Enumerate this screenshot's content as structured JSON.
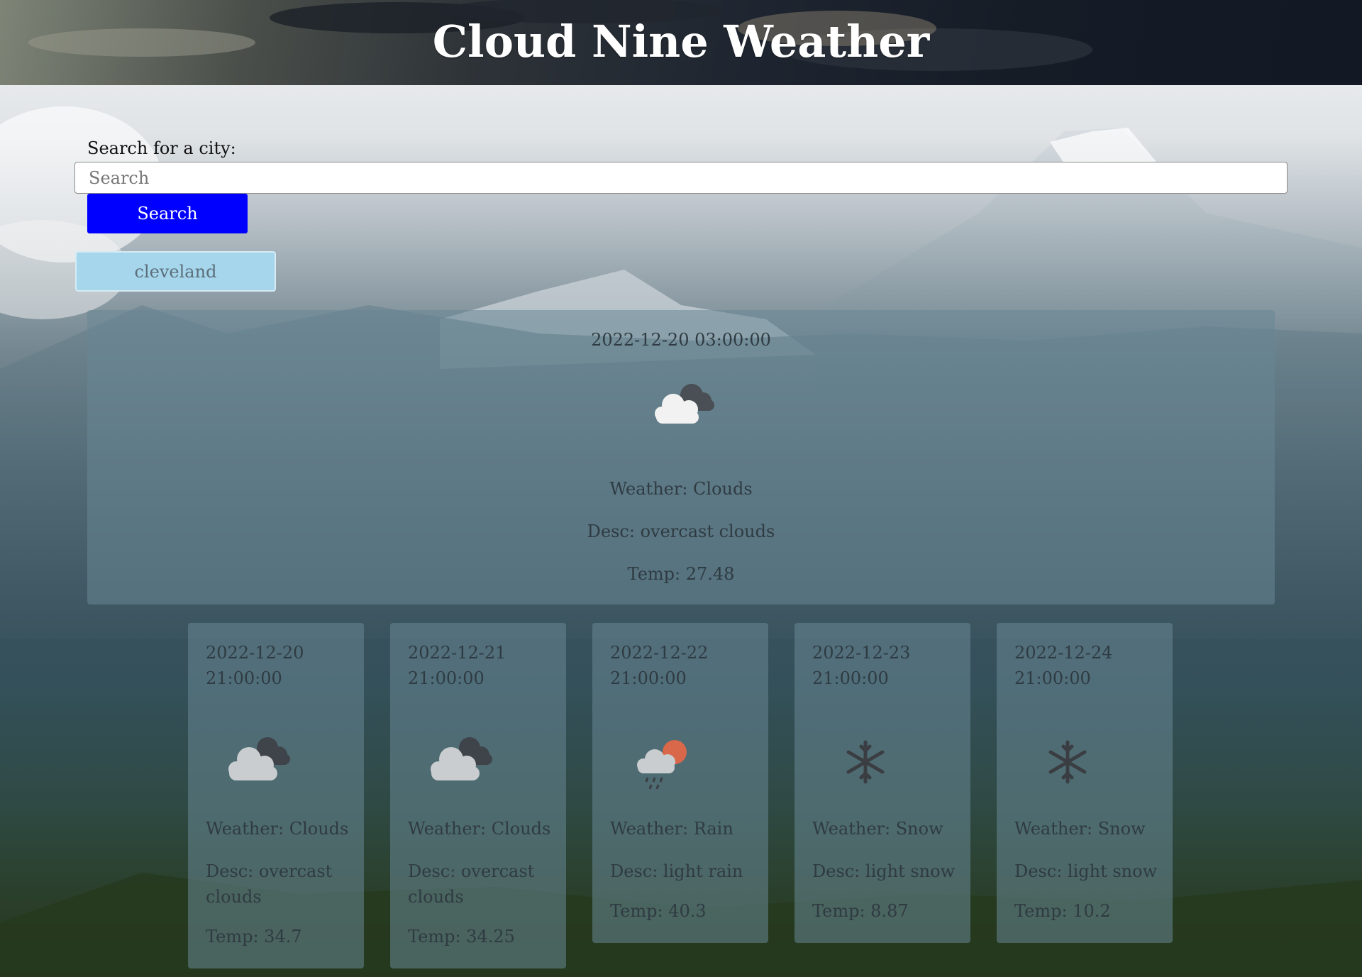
{
  "header": {
    "title": "Cloud Nine Weather"
  },
  "search": {
    "label": "Search for a city:",
    "placeholder": "Search",
    "value": "",
    "button_label": "Search"
  },
  "history": [
    {
      "label": "cleveland"
    }
  ],
  "current": {
    "date": "2022-12-20 03:00:00",
    "icon": "overcast-clouds-icon",
    "weather": "Weather: Clouds",
    "desc": "Desc: overcast clouds",
    "temp": "Temp: 27.48"
  },
  "forecast": [
    {
      "date_line1": "2022-12-20",
      "date_line2": "21:00:00",
      "icon": "overcast-clouds-icon",
      "weather": "Weather: Clouds",
      "desc_line1": "Desc: overcast",
      "desc_line2": "clouds",
      "temp": "Temp: 34.7"
    },
    {
      "date_line1": "2022-12-21",
      "date_line2": "21:00:00",
      "icon": "overcast-clouds-icon",
      "weather": "Weather: Clouds",
      "desc_line1": "Desc: overcast",
      "desc_line2": "clouds",
      "temp": "Temp: 34.25"
    },
    {
      "date_line1": "2022-12-22",
      "date_line2": "21:00:00",
      "icon": "rain-icon",
      "weather": "Weather: Rain",
      "desc_line1": "Desc: light rain",
      "desc_line2": "",
      "temp": "Temp: 40.3"
    },
    {
      "date_line1": "2022-12-23",
      "date_line2": "21:00:00",
      "icon": "snow-icon",
      "weather": "Weather: Snow",
      "desc_line1": "Desc: light snow",
      "desc_line2": "",
      "temp": "Temp: 8.87"
    },
    {
      "date_line1": "2022-12-24",
      "date_line2": "21:00:00",
      "icon": "snow-icon",
      "weather": "Weather: Snow",
      "desc_line1": "Desc: light snow",
      "desc_line2": "",
      "temp": "Temp: 10.2"
    }
  ],
  "colors": {
    "search_button": "#0000ff",
    "history_button": "#a6d6ec",
    "card_background": "rgba(104,134,148,0.55)"
  }
}
